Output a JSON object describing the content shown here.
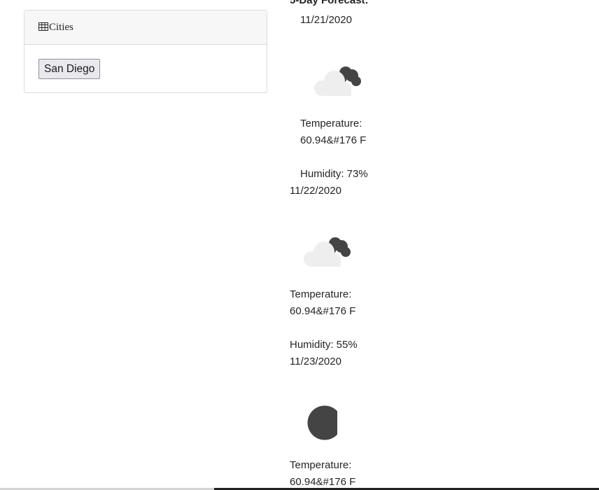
{
  "cities": {
    "header_icon": "table-icon",
    "header_label": "Cities",
    "buttons": [
      "San Diego"
    ]
  },
  "forecast": {
    "title": "5-Day Forecast:",
    "days": [
      {
        "date": "11/21/2020",
        "icon": "cloudy-icon",
        "temperature_label": "Temperature:",
        "temperature_value": "60.94&#176 F",
        "humidity": "Humidity: 73%"
      },
      {
        "date": "11/22/2020",
        "icon": "cloudy-icon",
        "temperature_label": "Temperature:",
        "temperature_value": "60.94&#176 F",
        "humidity": "Humidity: 55%"
      },
      {
        "date": "11/23/2020",
        "icon": "clear-sky-icon",
        "temperature_label": "Temperature:",
        "temperature_value": "60.94&#176 F"
      }
    ]
  },
  "colors": {
    "card_border": "#dcdcdc",
    "card_header_bg": "#f7f7f7",
    "text": "#212529",
    "icon_dark": "#444444",
    "icon_light": "#eeeeee"
  }
}
